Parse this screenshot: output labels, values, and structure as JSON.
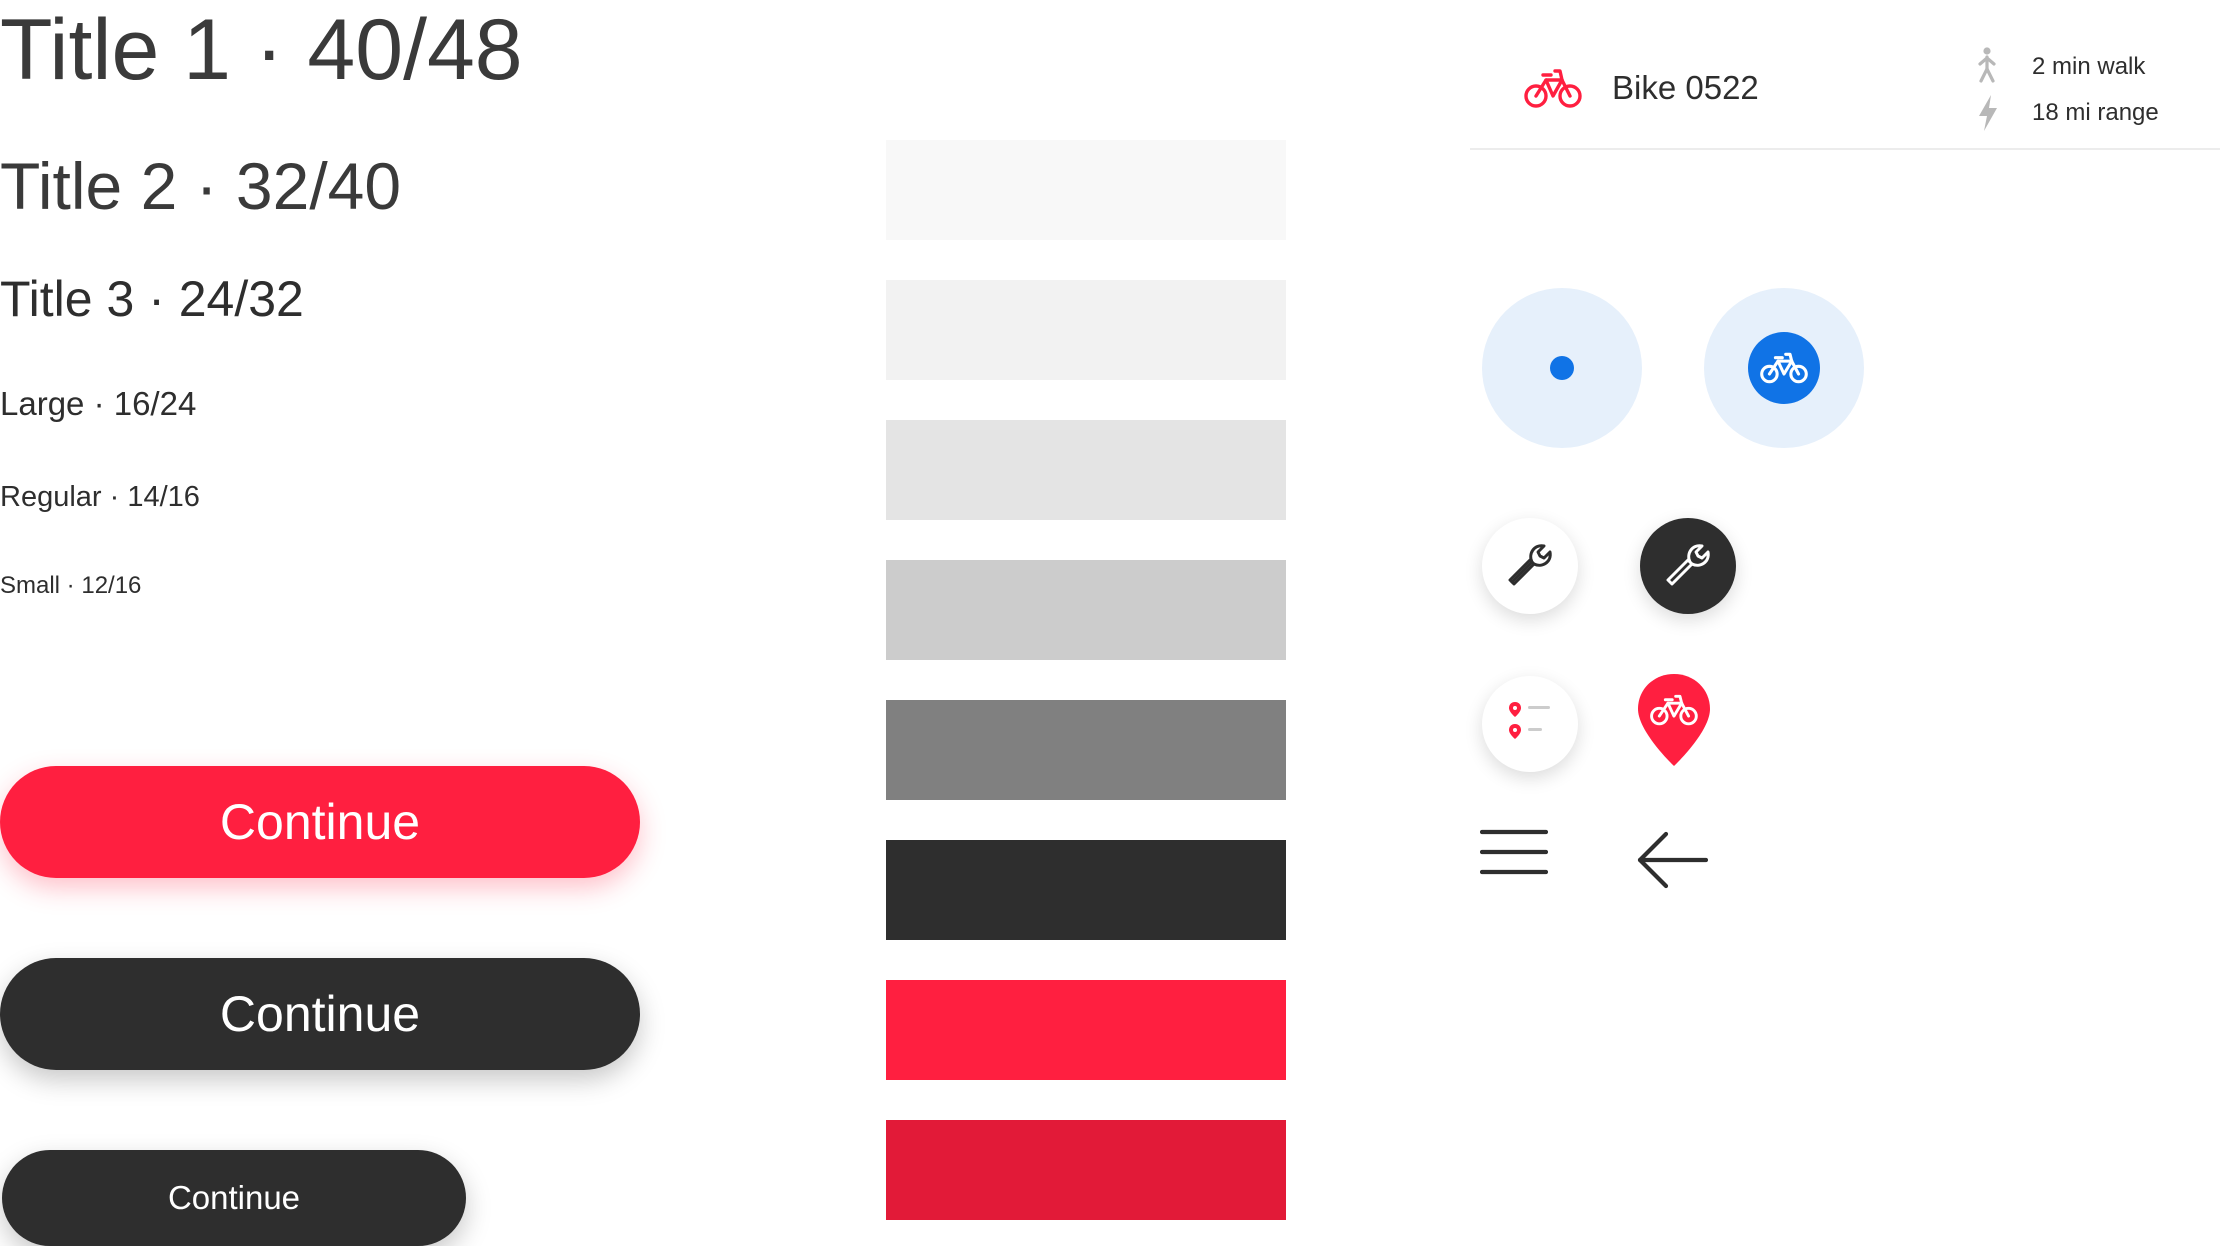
{
  "typography": {
    "title1": "Title 1 · 40/48",
    "title2": "Title 2 · 32/40",
    "title3": "Title 3 · 24/32",
    "large": "Large · 16/24",
    "regular": "Regular · 14/16",
    "small": "Small · 12/16"
  },
  "buttons": {
    "primary_label": "Continue",
    "secondary_label": "Continue",
    "small_label": "Continue"
  },
  "swatches": [
    {
      "color": "#f8f8f8"
    },
    {
      "color": "#f2f2f2"
    },
    {
      "color": "#e4e4e4"
    },
    {
      "color": "#cccccc"
    },
    {
      "color": "#808080"
    },
    {
      "color": "#2e2e2e"
    },
    {
      "color": "#ff1f40"
    },
    {
      "color": "#e21a38"
    }
  ],
  "bike_card": {
    "name": "Bike 0522",
    "walk": "2 min walk",
    "range": "18 mi range"
  },
  "colors": {
    "brand_red": "#ff1f40",
    "dark": "#2e2e2e",
    "blue": "#1073e6",
    "light_blue": "#e6f0fb",
    "meta_icon": "#b8b8b8"
  },
  "icons": [
    "bike-icon",
    "walk-icon",
    "bolt-icon",
    "location-dot-icon",
    "bike-marker-icon",
    "wrench-icon",
    "route-list-icon",
    "bike-pin-icon",
    "menu-icon",
    "back-arrow-icon"
  ]
}
